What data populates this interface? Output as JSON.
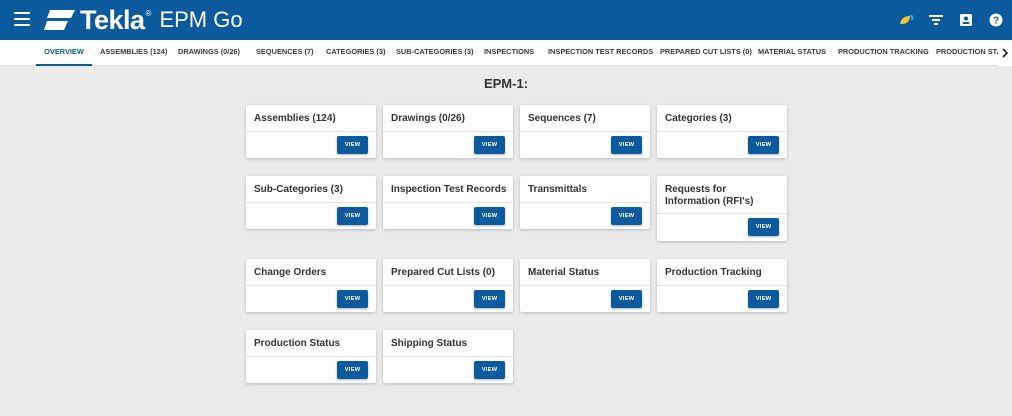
{
  "app": {
    "brand": "Tekla",
    "product": "EPM Go",
    "brand_color": "#0c5a9e"
  },
  "header_icons": [
    "leaf-icon",
    "filter-icon",
    "contact-card-icon",
    "help-icon"
  ],
  "tabs": [
    {
      "label": "OVERVIEW",
      "active": true
    },
    {
      "label": "ASSEMBLIES (124)"
    },
    {
      "label": "DRAWINGS (0/26)"
    },
    {
      "label": "SEQUENCES (7)"
    },
    {
      "label": "CATEGORIES (3)"
    },
    {
      "label": "SUB-CATEGORIES (3)"
    },
    {
      "label": "INSPECTIONS"
    },
    {
      "label": "INSPECTION TEST RECORDS"
    },
    {
      "label": "PREPARED CUT LISTS (0)"
    },
    {
      "label": "MATERIAL STATUS"
    },
    {
      "label": "PRODUCTION TRACKING"
    },
    {
      "label": "PRODUCTION STAT"
    }
  ],
  "page_title": "EPM-1:",
  "view_label": "VIEW",
  "cards": [
    {
      "title": "Assemblies (124)"
    },
    {
      "title": "Drawings (0/26)"
    },
    {
      "title": "Sequences (7)"
    },
    {
      "title": "Categories (3)"
    },
    {
      "title": "Sub-Categories (3)"
    },
    {
      "title": "Inspection Test Records"
    },
    {
      "title": "Transmittals"
    },
    {
      "title": "Requests for Information (RFI's)"
    },
    {
      "title": "Change Orders"
    },
    {
      "title": "Prepared Cut Lists (0)"
    },
    {
      "title": "Material Status"
    },
    {
      "title": "Production Tracking"
    },
    {
      "title": "Production Status"
    },
    {
      "title": "Shipping Status"
    }
  ]
}
